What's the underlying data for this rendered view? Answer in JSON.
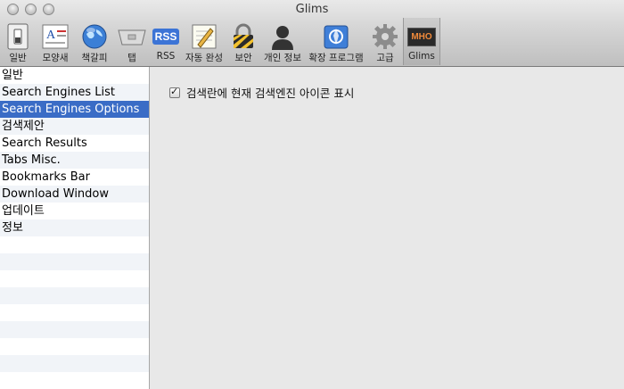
{
  "window": {
    "title": "Glims"
  },
  "toolbar": {
    "items": [
      {
        "label": "일반",
        "icon": "switch-icon"
      },
      {
        "label": "모양새",
        "icon": "appearance-icon"
      },
      {
        "label": "책갈피",
        "icon": "globe-icon"
      },
      {
        "label": "탭",
        "icon": "tab-icon"
      },
      {
        "label": "RSS",
        "icon": "rss-icon",
        "icon_text": "RSS"
      },
      {
        "label": "자동 완성",
        "icon": "pencil-icon"
      },
      {
        "label": "보안",
        "icon": "lock-icon"
      },
      {
        "label": "개인 정보",
        "icon": "person-icon"
      },
      {
        "label": "확장 프로그램",
        "icon": "puzzle-icon"
      },
      {
        "label": "고급",
        "icon": "gear-icon"
      },
      {
        "label": "Glims",
        "icon": "glims-icon",
        "icon_text": "MHO"
      }
    ],
    "active_index": 10
  },
  "sidebar": {
    "items": [
      {
        "label": "일반"
      },
      {
        "label": "Search Engines List"
      },
      {
        "label": "Search Engines Options"
      },
      {
        "label": "검색제안"
      },
      {
        "label": "Search Results"
      },
      {
        "label": "Tabs Misc."
      },
      {
        "label": "Bookmarks Bar"
      },
      {
        "label": "Download Window"
      },
      {
        "label": "업데이트"
      },
      {
        "label": "정보"
      }
    ],
    "selected_index": 2
  },
  "main": {
    "option": {
      "label": "검색란에 현재 검색엔진 아이콘 표시",
      "checked": true
    }
  },
  "colors": {
    "selection": "#3a6cc6"
  }
}
